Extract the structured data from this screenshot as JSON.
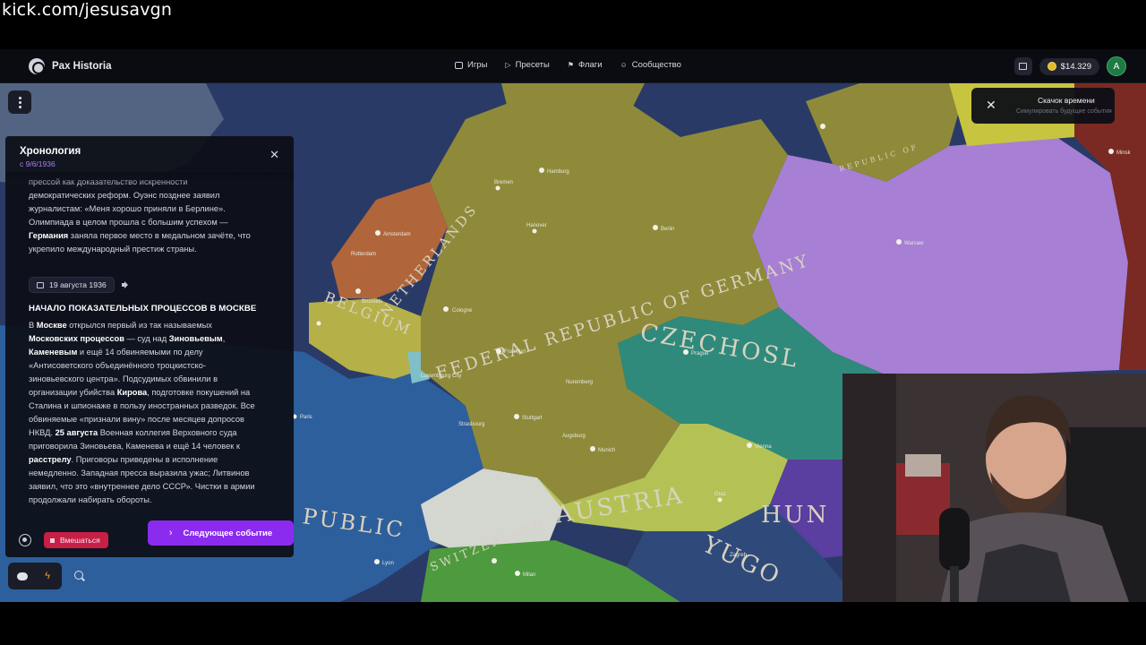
{
  "stream": {
    "url": "kick.com/jesusavgn"
  },
  "header": {
    "app_name": "Pax Historia",
    "nav": [
      {
        "label": "Игры",
        "icon": "gamepad-icon"
      },
      {
        "label": "Пресеты",
        "icon": "play-icon"
      },
      {
        "label": "Флаги",
        "icon": "flag-icon"
      },
      {
        "label": "Сообщество",
        "icon": "users-icon"
      }
    ],
    "balance": "$14.329",
    "avatar_letter": "A"
  },
  "time_skip": {
    "title": "Скачок времени",
    "subtitle": "Симулировать будущие события"
  },
  "map": {
    "labels": {
      "germany": "FEDERAL REPUBLIC OF GERMANY",
      "netherlands": "NETHERLANDS",
      "belgium": "BELGIUM",
      "czechoslovakia": "CZECHOSL",
      "austria": "AUSTRIA",
      "switzerland": "SWITZERLAND",
      "hungary": "HUN",
      "yugoslavia": "YUGO",
      "france": "PUBLIC",
      "baltic": "REPUBLIC OF"
    },
    "cities": [
      "Hamburg",
      "Bremen",
      "Hanover",
      "Berlin",
      "Amsterdam",
      "Rotterdam",
      "Brussels",
      "Cologne",
      "Frankfurt",
      "Luxembourg City",
      "Paris",
      "Strasbourg",
      "Stuttgart",
      "Munich",
      "Augsburg",
      "Nuremberg",
      "Prague",
      "Vienna",
      "Graz",
      "Warsaw",
      "Minsk",
      "Lyon",
      "Milan",
      "Zagreb"
    ]
  },
  "timeline": {
    "title": "Хронология",
    "since": "с 9/6/1936",
    "previous_text": {
      "l1": "прессой как доказательство искренности",
      "l2": "демократических реформ. Оуэнс позднее заявил",
      "l3": "журналистам: «Меня хорошо приняли в Берлине».",
      "l4": "Олимпиада в целом прошла с большим успехом —",
      "l5_bold": "Германия",
      "l5_rest": " заняла первое место в медальном зачёте, что",
      "l6": "укрепило международный престиж страны."
    },
    "event": {
      "date": "19 августа 1936",
      "title": "НАЧАЛО ПОКАЗАТЕЛЬНЫХ ПРОЦЕССОВ В МОСКВЕ",
      "p1": "В ",
      "b1": "Москве",
      "p2": " открылся первый из так называемых",
      "b2": "Московских процессов",
      "p3": " — суд над ",
      "b3": "Зиновьевым",
      "p3b": ",",
      "b4": "Каменевым",
      "p4": " и ещё 14 обвиняемыми по делу",
      "p5": "«Антисоветского объединённого троцкистско-",
      "p6": "зиновьевского центра». Подсудимых обвинили в",
      "p7": "организации убийства ",
      "b5": "Кирова",
      "p8": ", подготовке покушений на",
      "p9": "Сталина и шпионаже в пользу иностранных разведок. Все",
      "p10": "обвиняемые «признали вину» после месяцев допросов",
      "p11": "НКВД. ",
      "b6": "25 августа",
      "p12": " Военная коллегия Верховного суда",
      "p13": "приговорила Зиновьева, Каменева и ещё 14 человек к",
      "b7": "расстрелу",
      "p14": ". Приговоры приведены в исполнение",
      "p15": "немедленно. Западная пресса выразила ужас; Литвинов",
      "p16": "заявил, что это «внутреннее дело СССР». Чистки в армии",
      "p17": "продолжали набирать обороты."
    },
    "intervene_label": "Вмешаться",
    "next_event_label": "Следующее событие"
  },
  "colors": {
    "accent": "#8b2bf0",
    "intervene": "#c71f46",
    "germany": "#8e8a3a",
    "czechoslovakia": "#2f8a7c",
    "austria": "#b4c255",
    "poland": "#a77fd4",
    "france": "#2d5f9c",
    "sea": "#2a3a66"
  }
}
